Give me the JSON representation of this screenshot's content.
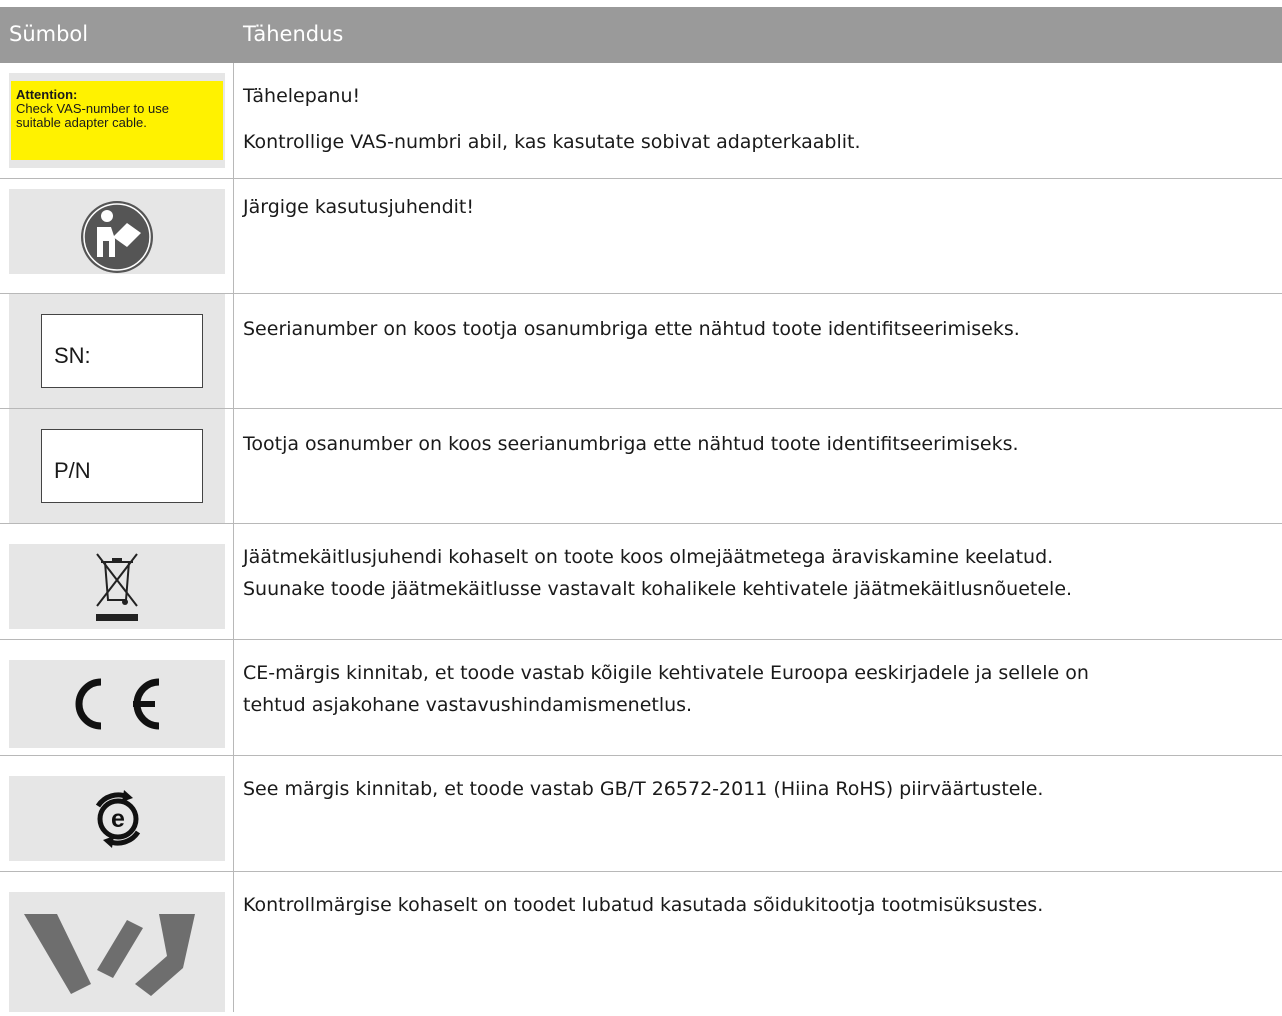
{
  "header": {
    "symbol_label": "Sümbol",
    "meaning_label": "Tähendus"
  },
  "rows": [
    {
      "icon": "attention-label",
      "label_title": "Attention:",
      "label_line1": "Check VAS-number to use",
      "label_line2": "suitable adapter cable.",
      "text1": "Tähelepanu!",
      "text2": "Kontrollige VAS-numbri abil, kas kasutate sobivat adapterkaablit."
    },
    {
      "icon": "read-manual-icon",
      "text1": "Järgige kasutusjuhendit!"
    },
    {
      "icon": "serial-number-label",
      "label": "SN:",
      "text1": "Seerianumber on koos tootja osanumbriga ette nähtud toote identifitseerimiseks."
    },
    {
      "icon": "part-number-label",
      "label": "P/N",
      "text1": "Tootja osanumber on koos seerianumbriga ette nähtud toote identifitseerimiseks."
    },
    {
      "icon": "weee-crossed-bin-icon",
      "text1": "Jäätmekäitlusjuhendi kohaselt on toote koos olmejäätmetega äraviskamine keelatud.",
      "text2": "Suunake toode jäätmekäitlusse vastavalt kohalikele kehtivatele jäätmekäitlusnõuetele."
    },
    {
      "icon": "ce-mark-icon",
      "text1": "CE-märgis kinnitab, et toode vastab kõigile kehtivatele Euroopa eeskirjadele ja sellele on",
      "text2": "tehtud asjakohane vastavushindamismenetlus."
    },
    {
      "icon": "china-rohs-e-icon",
      "text1": "See märgis kinnitab, et toode vastab GB/T 26572-2011 (Hiina RoHS) piirväärtustele."
    },
    {
      "icon": "inspection-mark-icon",
      "text1": "Kontrollmärgise kohaselt on toodet lubatud kasutada sõidukitootja tootmisüksustes."
    }
  ]
}
